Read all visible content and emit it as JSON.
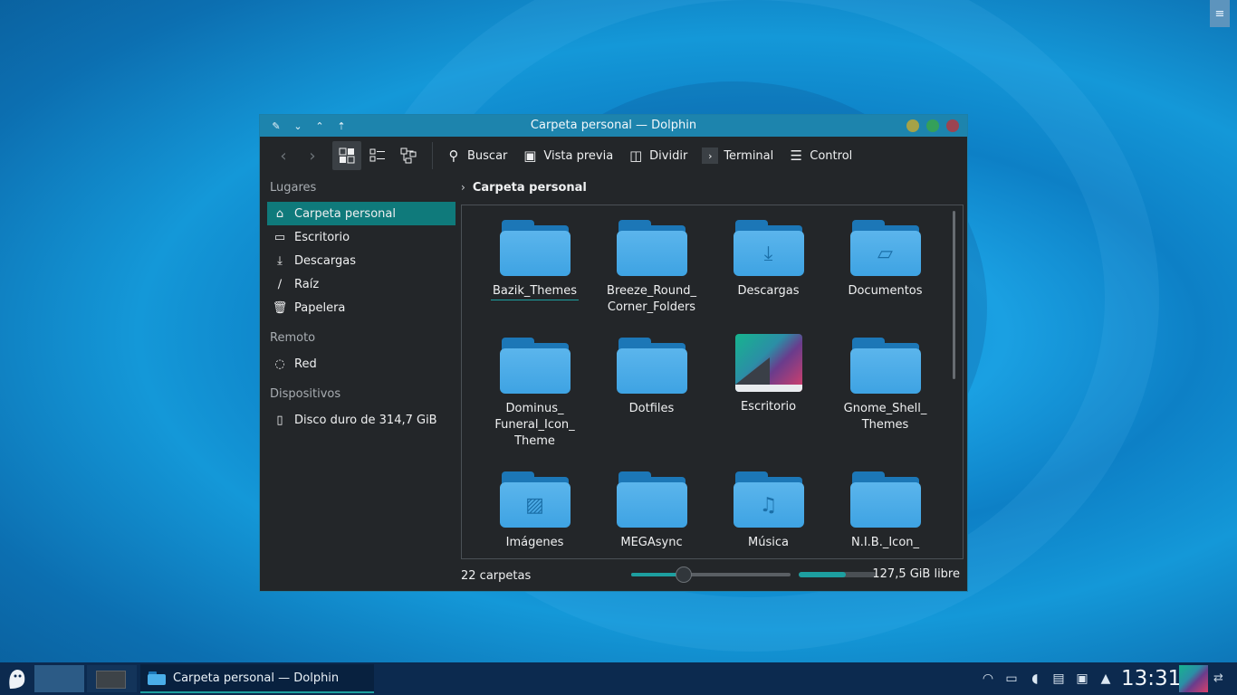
{
  "window": {
    "title": "Carpeta personal — Dolphin"
  },
  "toolbar": {
    "search": "Buscar",
    "preview": "Vista previa",
    "split": "Dividir",
    "terminal": "Terminal",
    "control": "Control"
  },
  "sidebar": {
    "places_header": "Lugares",
    "places": [
      {
        "label": "Carpeta personal",
        "icon": "home-icon"
      },
      {
        "label": "Escritorio",
        "icon": "desktop-icon"
      },
      {
        "label": "Descargas",
        "icon": "download-icon"
      },
      {
        "label": "Raíz",
        "icon": "root-icon"
      },
      {
        "label": "Papelera",
        "icon": "trash-icon"
      }
    ],
    "remote_header": "Remoto",
    "remote": [
      {
        "label": "Red",
        "icon": "network-icon"
      }
    ],
    "devices_header": "Dispositivos",
    "devices": [
      {
        "label": "Disco duro de 314,7 GiB",
        "icon": "drive-icon"
      }
    ]
  },
  "breadcrumb": {
    "current": "Carpeta personal"
  },
  "files": [
    {
      "label": "Bazik_Themes",
      "type": "folder"
    },
    {
      "label": "Breeze_Round_ Corner_Folders",
      "type": "folder"
    },
    {
      "label": "Descargas",
      "type": "folder-download"
    },
    {
      "label": "Documentos",
      "type": "folder-documents"
    },
    {
      "label": "Dominus_ Funeral_Icon_ Theme",
      "type": "folder"
    },
    {
      "label": "Dotfiles",
      "type": "folder"
    },
    {
      "label": "Escritorio",
      "type": "desktop-thumbnail"
    },
    {
      "label": "Gnome_Shell_ Themes",
      "type": "folder"
    },
    {
      "label": "Imágenes",
      "type": "folder-pictures"
    },
    {
      "label": "MEGAsync",
      "type": "folder"
    },
    {
      "label": "Música",
      "type": "folder-music"
    },
    {
      "label": "N.I.B._Icon_",
      "type": "folder"
    }
  ],
  "status": {
    "count": "22 carpetas",
    "zoom_fraction": 0.33,
    "space_used_fraction": 0.6,
    "free": "127,5 GiB libre"
  },
  "taskbar": {
    "task_label": "Carpeta personal — Dolphin",
    "clock": "13:31"
  },
  "colors": {
    "accent": "#1d9fa0",
    "selection": "#0f7a7b",
    "titlebar": "#1d84ad",
    "window_bg": "#232629",
    "folder": "#3ea3e3"
  }
}
